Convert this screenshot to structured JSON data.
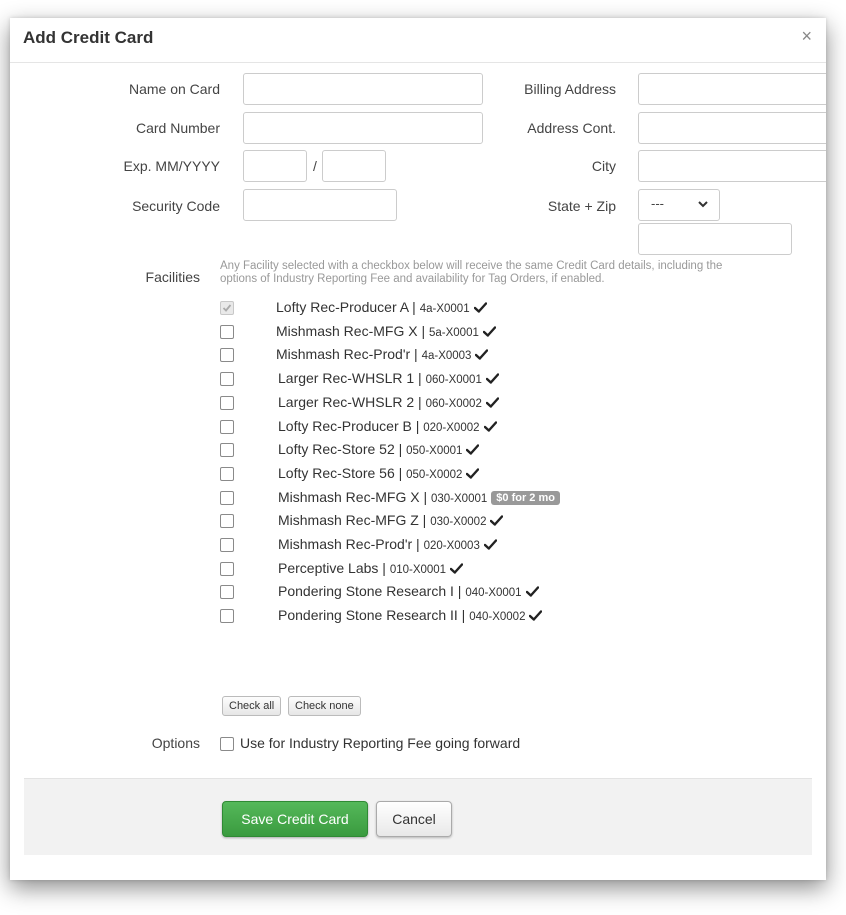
{
  "modal": {
    "title": "Add Credit Card",
    "close_glyph": "×"
  },
  "form": {
    "name_on_card": {
      "label": "Name on Card",
      "value": ""
    },
    "card_number": {
      "label": "Card Number",
      "value": ""
    },
    "exp": {
      "label": "Exp. MM/YYYY",
      "month": "",
      "separator": "/",
      "year": ""
    },
    "security_code": {
      "label": "Security Code",
      "value": ""
    },
    "billing_address": {
      "label": "Billing Address",
      "value": ""
    },
    "address_cont": {
      "label": "Address Cont.",
      "value": ""
    },
    "city": {
      "label": "City",
      "value": ""
    },
    "state_zip": {
      "label": "State + Zip",
      "state_selected": "---",
      "zip": ""
    }
  },
  "facilities": {
    "label": "Facilities",
    "help_text": "Any Facility selected with a checkbox below will receive the same Credit Card details, including the options of Industry Reporting Fee and availability for Tag Orders, if enabled.",
    "items": [
      {
        "name": "Lofty Rec-Producer A | ",
        "code": "4a-X0001",
        "status": "check",
        "checked": true,
        "disabled": true
      },
      {
        "name": "Mishmash Rec-MFG X | ",
        "code": "5a-X0001",
        "status": "check",
        "checked": false,
        "disabled": false
      },
      {
        "name": "Mishmash Rec-Prod'r | ",
        "code": "4a-X0003",
        "status": "check",
        "checked": false,
        "disabled": false
      },
      {
        "name": "Larger Rec-WHSLR 1 | ",
        "code": "060-X0001",
        "status": "check",
        "checked": false,
        "disabled": false
      },
      {
        "name": "Larger Rec-WHSLR 2 | ",
        "code": "060-X0002",
        "status": "check",
        "checked": false,
        "disabled": false
      },
      {
        "name": "Lofty Rec-Producer B | ",
        "code": "020-X0002",
        "status": "check",
        "checked": false,
        "disabled": false
      },
      {
        "name": "Lofty Rec-Store 52 | ",
        "code": "050-X0001",
        "status": "check",
        "checked": false,
        "disabled": false
      },
      {
        "name": "Lofty Rec-Store 56 | ",
        "code": "050-X0002",
        "status": "check",
        "checked": false,
        "disabled": false
      },
      {
        "name": "Mishmash Rec-MFG X | ",
        "code": "030-X0001",
        "status": "promo",
        "promo": "$0 for 2 mo",
        "checked": false,
        "disabled": false
      },
      {
        "name": "Mishmash Rec-MFG Z | ",
        "code": "030-X0002",
        "status": "check",
        "checked": false,
        "disabled": false
      },
      {
        "name": "Mishmash Rec-Prod'r | ",
        "code": "020-X0003",
        "status": "check",
        "checked": false,
        "disabled": false
      },
      {
        "name": "Perceptive Labs | ",
        "code": "010-X0001",
        "status": "check",
        "checked": false,
        "disabled": false
      },
      {
        "name": "Pondering Stone Research I | ",
        "code": "040-X0001",
        "status": "check",
        "checked": false,
        "disabled": false
      },
      {
        "name": "Pondering Stone Research II | ",
        "code": "040-X0002",
        "status": "check",
        "checked": false,
        "disabled": false
      }
    ],
    "check_all": "Check all",
    "check_none": "Check none"
  },
  "options": {
    "label": "Options",
    "industry_fee": {
      "label": "Use for Industry Reporting Fee going forward",
      "checked": false
    }
  },
  "footer": {
    "save": "Save Credit Card",
    "cancel": "Cancel"
  },
  "colors": {
    "save_green": "#43a047",
    "promo_gray": "#999999"
  }
}
